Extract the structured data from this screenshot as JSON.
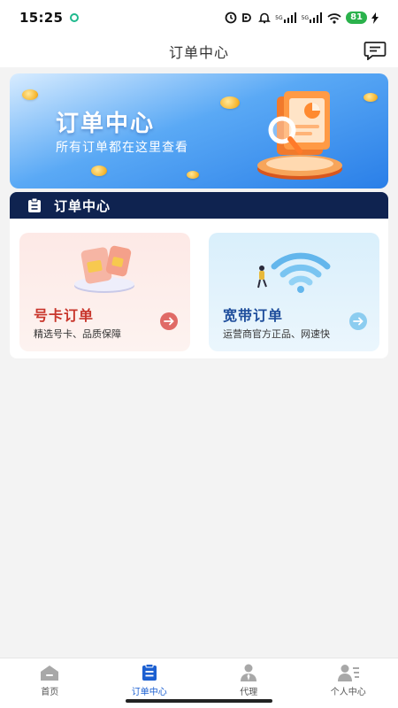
{
  "status_bar": {
    "time": "15:25",
    "network_labels": [
      "5G",
      "5G"
    ],
    "battery": "81"
  },
  "header": {
    "title": "订单中心",
    "message_icon": "message-icon"
  },
  "banner": {
    "title": "订单中心",
    "subtitle": "所有订单都在这里查看",
    "accent_color": "#2a7fe8"
  },
  "section": {
    "title": "订单中心",
    "icon": "clipboard-icon",
    "background": "#0f2350"
  },
  "cards": [
    {
      "title": "号卡订单",
      "description": "精选号卡、品质保障",
      "title_color": "#c8352b"
    },
    {
      "title": "宽带订单",
      "description": "运营商官方正品、网速快",
      "title_color": "#1f4e9c"
    }
  ],
  "tabs": [
    {
      "label": "首页",
      "icon": "home-icon",
      "active": false
    },
    {
      "label": "订单中心",
      "icon": "order-icon",
      "active": true
    },
    {
      "label": "代理",
      "icon": "agent-icon",
      "active": false
    },
    {
      "label": "个人中心",
      "icon": "profile-icon",
      "active": false
    }
  ],
  "colors": {
    "active_tab": "#1b5fd1",
    "inactive_tab_icon": "#a8a8a8"
  }
}
